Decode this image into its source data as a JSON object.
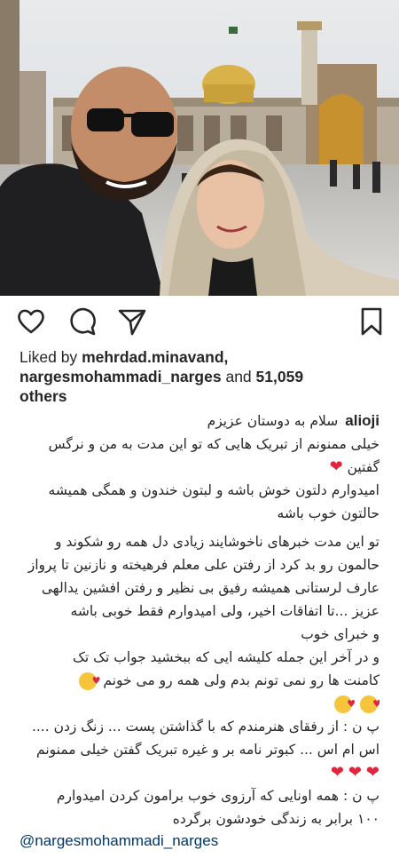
{
  "post": {
    "image_alt": "selfie photo at shrine courtyard",
    "likes": {
      "prefix": "Liked by",
      "user1": "mehrdad.minavand,",
      "user2": "nargesmohammadi_narges",
      "and": "and",
      "count": "51,059",
      "others": "others"
    },
    "caption": {
      "username": "alioji",
      "lines": [
        "سلام به دوستان عزیزم",
        "خیلی ممنونم از تبریک هایی که تو این مدت به من و نرگس",
        "گفتین",
        "امیدوارم دلتون خوش باشه و لبتون خندون و همگی  همیشه",
        "حالتون خوب باشه",
        "تو این مدت خبرهای ناخوشایند زیادی دل همه رو شکوند و",
        "حالمون رو بد کرد از رفتن علی معلم فرهیخته و نازنین تا پرواز",
        "عارف لرستانی همیشه رفیق بی نظیر و رفتن افشین یدالهی",
        "عزیز ...تا اتفاقات اخیر، ولی امیدوارم فقط خوبی باشه",
        "و خبرای خوب",
        "و در آخر این جمله کلیشه ایی که ببخشید جواب تک تک",
        "کامنت ها  رو نمی تونم بدم ولی همه رو می خونم",
        "پ ن : از رفقای هنرمندم که با گذاشتن پست ... زنگ زدن ....",
        "اس ام اس ... کبوتر نامه بر و غیره تبریک گفتن خیلی ممنونم",
        "پ ن : همه اونایی که آرزوی خوب برامون کردن امیدوارم",
        "۱۰۰ برابر به زندگی خودشون برگرده"
      ],
      "heart": "❤️",
      "mention": "@nargesmohammadi_narges"
    }
  },
  "icons": {
    "like": "heart-icon",
    "comment": "comment-icon",
    "share": "send-icon",
    "save": "bookmark-icon"
  }
}
